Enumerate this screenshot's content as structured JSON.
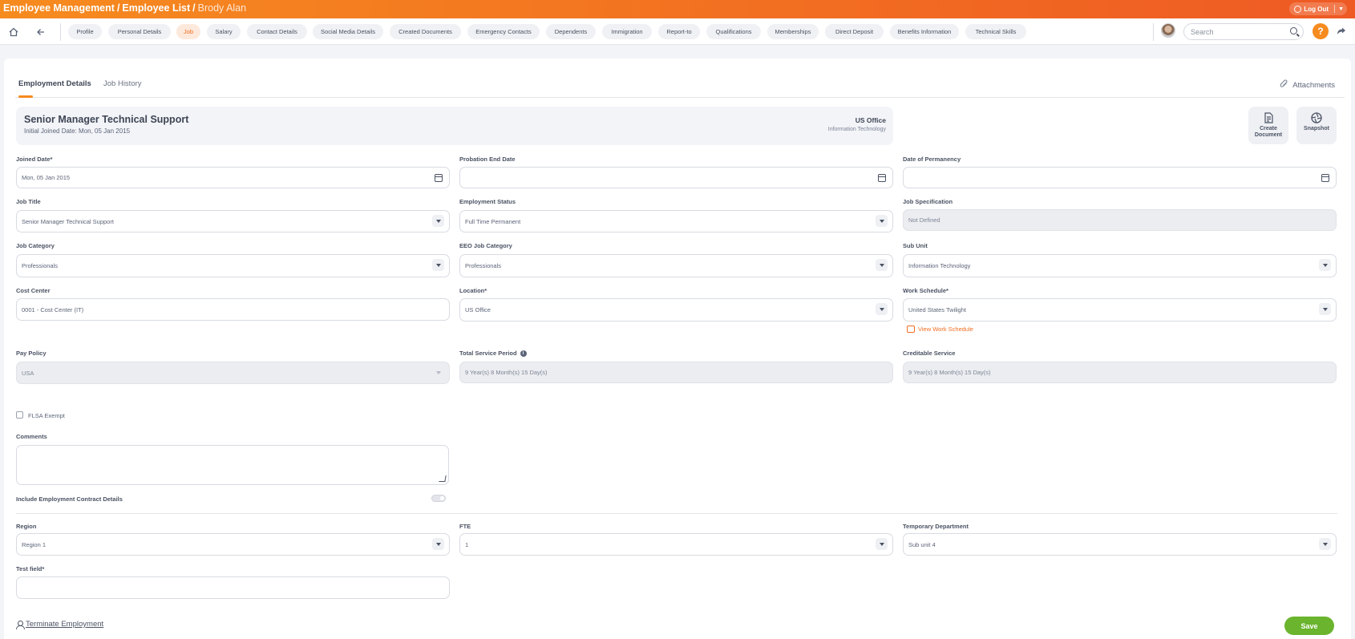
{
  "header": {
    "module": "Employee Management",
    "list": "Employee List",
    "employee": "Brody Alan",
    "logout_label": "Log Out"
  },
  "nav": {
    "tabs": [
      "Profile",
      "Personal Details",
      "Job",
      "Salary",
      "Contact Details",
      "Social Media Details",
      "Created Documents",
      "Emergency Contacts",
      "Dependents",
      "Immigration",
      "Report-to",
      "Qualifications",
      "Memberships",
      "Direct Deposit",
      "Benefits Information",
      "Technical Skills"
    ],
    "active_tab": "Job",
    "search_placeholder": "Search",
    "help_label": "?"
  },
  "subtabs": {
    "employment_details": "Employment Details",
    "job_history": "Job History",
    "attachments": "Attachments"
  },
  "summary": {
    "job_title": "Senior Manager Technical Support",
    "initial_joined": "Initial Joined Date: Mon, 05 Jan 2015",
    "location": "US Office",
    "department": "Information Technology"
  },
  "actions": {
    "create_document": "Create Document",
    "snapshot": "Snapshot"
  },
  "form": {
    "joined_date": {
      "label": "Joined Date*",
      "value": "Mon, 05 Jan 2015"
    },
    "probation_end_date": {
      "label": "Probation End Date",
      "value": ""
    },
    "date_of_permanency": {
      "label": "Date of Permanency",
      "value": ""
    },
    "job_title": {
      "label": "Job Title",
      "value": "Senior Manager Technical Support"
    },
    "employment_status": {
      "label": "Employment Status",
      "value": "Full Time Permanent"
    },
    "job_specification": {
      "label": "Job Specification",
      "value": "Not Defined"
    },
    "job_category": {
      "label": "Job Category",
      "value": "Professionals"
    },
    "eeo_job_category": {
      "label": "EEO Job Category",
      "value": "Professionals"
    },
    "sub_unit": {
      "label": "Sub Unit",
      "value": "Information Technology"
    },
    "cost_center": {
      "label": "Cost Center",
      "value": "0001 - Cost Center (IT)"
    },
    "location": {
      "label": "Location*",
      "value": "US Office"
    },
    "work_schedule": {
      "label": "Work Schedule*",
      "value": "United States Twilight"
    },
    "view_work_schedule": "View Work Schedule",
    "pay_policy": {
      "label": "Pay Policy",
      "value": "USA"
    },
    "total_service_period": {
      "label": "Total Service Period",
      "value": "9 Year(s) 8 Month(s) 15 Day(s)"
    },
    "creditable_service": {
      "label": "Creditable Service",
      "value": "9 Year(s) 8 Month(s) 15 Day(s)"
    },
    "flsa_exempt": {
      "label": "FLSA Exempt",
      "checked": false
    },
    "comments": {
      "label": "Comments",
      "value": ""
    },
    "include_contract": {
      "label": "Include Employment Contract Details",
      "on": false
    },
    "region": {
      "label": "Region",
      "value": "Region 1"
    },
    "fte": {
      "label": "FTE",
      "value": "1"
    },
    "temporary_department": {
      "label": "Temporary Department",
      "value": "Sub unit 4"
    },
    "test_field": {
      "label": "Test field*",
      "value": ""
    }
  },
  "footer": {
    "terminate": "Terminate Employment",
    "save": "Save"
  },
  "colors": {
    "accent": "#f68b1f",
    "save": "#6ab42e"
  }
}
